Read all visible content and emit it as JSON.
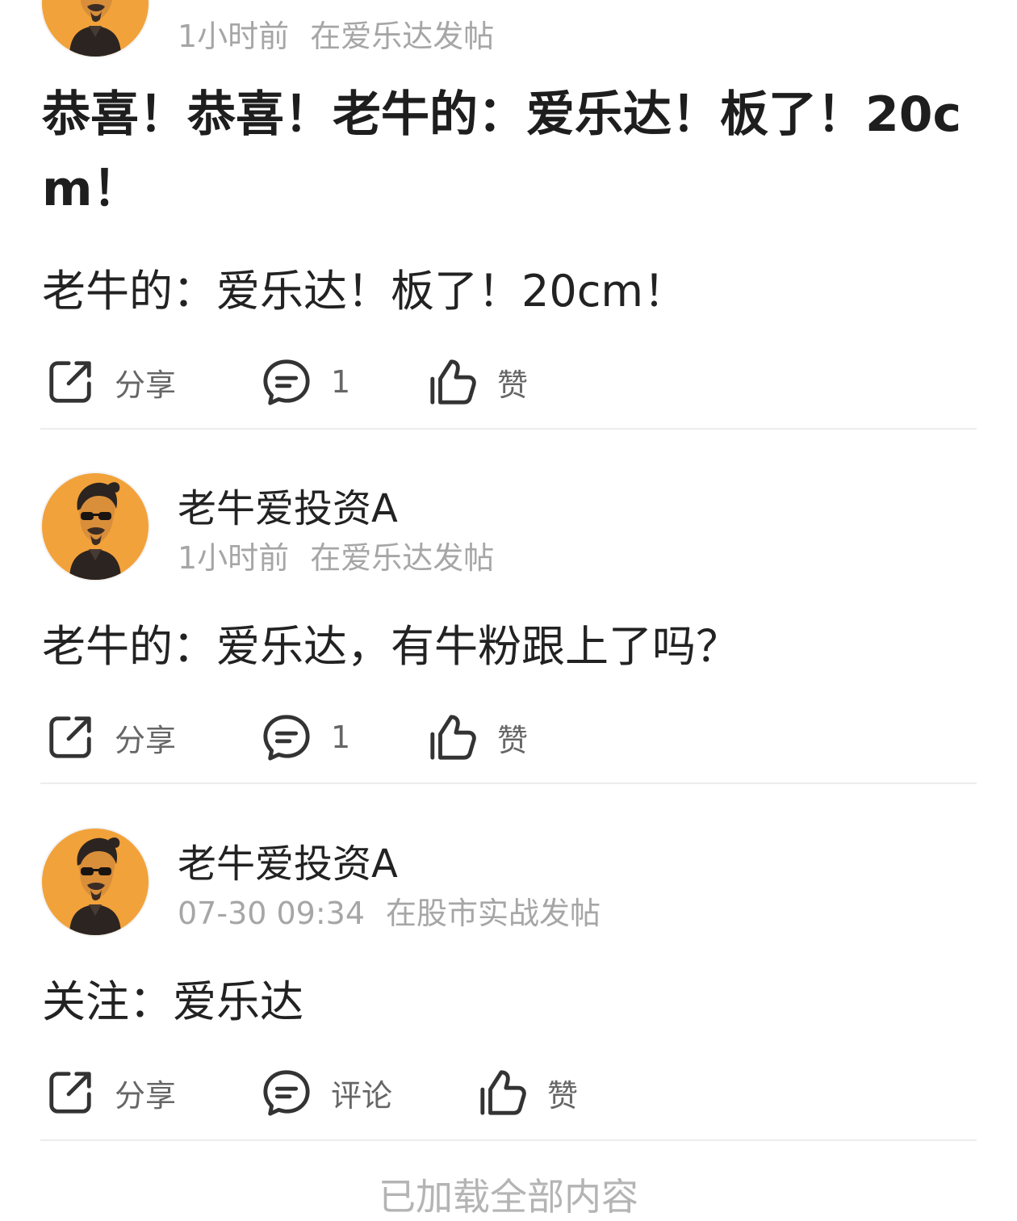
{
  "posts": [
    {
      "author": "",
      "time": "1小时前",
      "location": "在爱乐达发帖",
      "title": "恭喜！恭喜！老牛的：爱乐达！板了！20cm！",
      "content": "老牛的：爱乐达！板了！20cm！",
      "actions": {
        "share": "分享",
        "comment": "1",
        "like": "赞"
      }
    },
    {
      "author": "老牛爱投资A",
      "time": "1小时前",
      "location": "在爱乐达发帖",
      "title": "",
      "content": "老牛的：爱乐达，有牛粉跟上了吗？",
      "actions": {
        "share": "分享",
        "comment": "1",
        "like": "赞"
      }
    },
    {
      "author": "老牛爱投资A",
      "time": "07-30 09:34",
      "location": "在股市实战发帖",
      "title": "",
      "content": "关注：爱乐达",
      "actions": {
        "share": "分享",
        "comment": "评论",
        "like": "赞"
      }
    }
  ],
  "footer": "已加载全部内容",
  "icons": {
    "share": "share-icon",
    "comment": "comment-icon",
    "like": "thumbs-up-icon"
  },
  "colors": {
    "avatar_bg": "#f2a23a",
    "meta": "#a6a6a6",
    "divider": "#ececec"
  }
}
